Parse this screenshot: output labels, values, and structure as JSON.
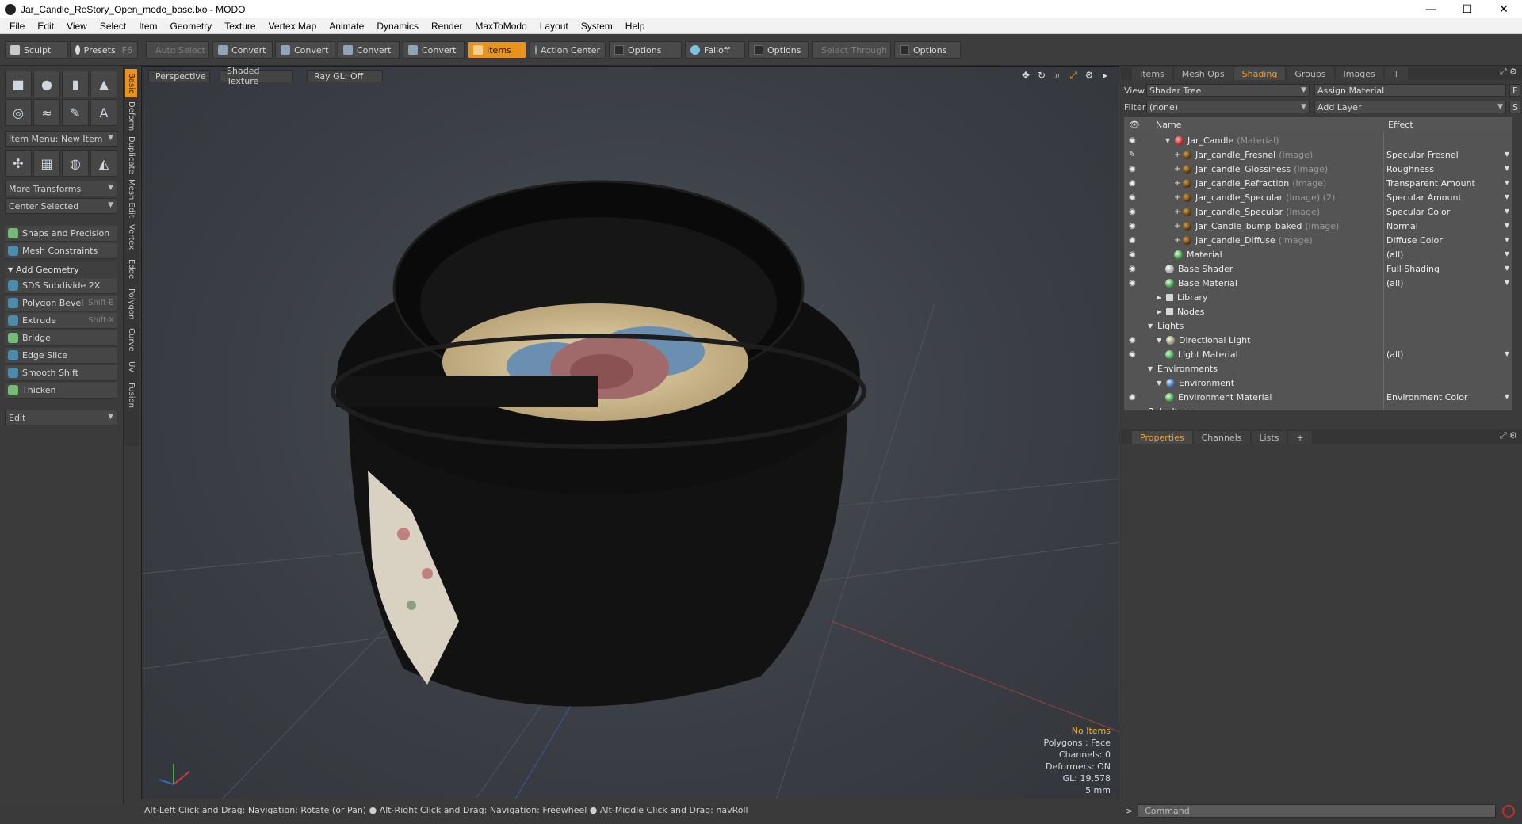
{
  "window": {
    "title": "Jar_Candle_ReStory_Open_modo_base.lxo - MODO",
    "minimize": "—",
    "maximize": "☐",
    "close": "✕"
  },
  "menu": [
    "File",
    "Edit",
    "View",
    "Select",
    "Item",
    "Geometry",
    "Texture",
    "Vertex Map",
    "Animate",
    "Dynamics",
    "Render",
    "MaxToModo",
    "Layout",
    "System",
    "Help"
  ],
  "toolbar": {
    "sculpt": "Sculpt",
    "presets": "Presets",
    "presets_hotkey": "F6",
    "auto_select": "Auto Select",
    "convert1": "Convert",
    "convert2": "Convert",
    "convert3": "Convert",
    "convert4": "Convert",
    "items": "Items",
    "action_center": "Action Center",
    "options1": "Options",
    "falloff": "Falloff",
    "options2": "Options",
    "select_through": "Select Through",
    "options3": "Options"
  },
  "left": {
    "item_menu": "Item Menu: New Item",
    "more_transforms": "More Transforms",
    "center_selected": "Center Selected",
    "snaps": "Snaps and Precision",
    "mesh_constraints": "Mesh Constraints",
    "add_geometry": "Add Geometry",
    "tools": [
      {
        "label": "SDS Subdivide 2X",
        "hotkey": ""
      },
      {
        "label": "Polygon Bevel",
        "hotkey": "Shift-B"
      },
      {
        "label": "Extrude",
        "hotkey": "Shift-X"
      },
      {
        "label": "Bridge",
        "hotkey": ""
      },
      {
        "label": "Edge Slice",
        "hotkey": ""
      },
      {
        "label": "Smooth Shift",
        "hotkey": ""
      },
      {
        "label": "Thicken",
        "hotkey": ""
      }
    ],
    "edit": "Edit"
  },
  "sidetabs": [
    "Basic",
    "Deform",
    "Duplicate",
    "Mesh Edit",
    "Vertex",
    "Edge",
    "Polygon",
    "Curve",
    "UV",
    "Fusion"
  ],
  "viewport": {
    "perspective": "Perspective",
    "shaded_texture": "Shaded Texture",
    "ray_gl": "Ray GL: Off",
    "info": {
      "no_items": "No Items",
      "polygons": "Polygons : Face",
      "channels": "Channels: 0",
      "deformers": "Deformers: ON",
      "gl": "GL: 19,578",
      "unit": "5 mm"
    }
  },
  "statusbar": "Alt-Left Click and Drag: Navigation: Rotate (or Pan) ● Alt-Right Click and Drag: Navigation: Freewheel ● Alt-Middle Click and Drag: navRoll",
  "right": {
    "tabs": [
      "Items",
      "Mesh Ops",
      "Shading",
      "Groups",
      "Images"
    ],
    "plus": "+",
    "view_label": "View",
    "view_value": "Shader Tree",
    "assign_material": "Assign Material",
    "f_btn": "F",
    "filter_label": "Filter",
    "filter_value": "(none)",
    "add_layer": "Add Layer",
    "s_btn": "S",
    "col_name": "Name",
    "col_effect": "Effect",
    "tree": [
      {
        "name": "Jar_Candle",
        "sub": "(Material)",
        "effect": "",
        "indent": 2,
        "icon": "red",
        "eye": true,
        "tri": "▼"
      },
      {
        "name": "Jar_candle_Fresnel",
        "sub": "(Image)",
        "effect": "Specular Fresnel",
        "indent": 3,
        "icon": "img",
        "eye": "brush",
        "plus": true
      },
      {
        "name": "Jar_candle_Glossiness",
        "sub": "(Image)",
        "effect": "Roughness",
        "indent": 3,
        "icon": "img",
        "eye": true,
        "plus": true
      },
      {
        "name": "Jar_candle_Refraction",
        "sub": "(Image)",
        "effect": "Transparent Amount",
        "indent": 3,
        "icon": "img",
        "eye": true,
        "plus": true
      },
      {
        "name": "Jar_candle_Specular",
        "sub": "(Image) (2)",
        "effect": "Specular Amount",
        "indent": 3,
        "icon": "img",
        "eye": true,
        "plus": true
      },
      {
        "name": "Jar_candle_Specular",
        "sub": "(Image)",
        "effect": "Specular Color",
        "indent": 3,
        "icon": "img",
        "eye": true,
        "plus": true
      },
      {
        "name": "Jar_Candle_bump_baked",
        "sub": "(Image)",
        "effect": "Normal",
        "indent": 3,
        "icon": "img",
        "eye": true,
        "plus": true
      },
      {
        "name": "Jar_candle_Diffuse",
        "sub": "(Image)",
        "effect": "Diffuse Color",
        "indent": 3,
        "icon": "img",
        "eye": true,
        "plus": true
      },
      {
        "name": "Material",
        "sub": "",
        "effect": "(all)",
        "indent": 3,
        "icon": "mat",
        "eye": true
      },
      {
        "name": "Base Shader",
        "sub": "",
        "effect": "Full Shading",
        "indent": 2,
        "icon": "shader",
        "eye": true
      },
      {
        "name": "Base Material",
        "sub": "",
        "effect": "(all)",
        "indent": 2,
        "icon": "mat",
        "eye": true
      },
      {
        "name": "Library",
        "sub": "",
        "effect": "",
        "indent": 1,
        "icon": "folder",
        "eye": false,
        "tri": "▶"
      },
      {
        "name": "Nodes",
        "sub": "",
        "effect": "",
        "indent": 1,
        "icon": "folder",
        "eye": false,
        "tri": "▶"
      },
      {
        "name": "Lights",
        "sub": "",
        "effect": "",
        "indent": 0,
        "icon": "",
        "eye": false,
        "tri": "▼"
      },
      {
        "name": "Directional Light",
        "sub": "",
        "effect": "",
        "indent": 1,
        "icon": "light",
        "eye": true,
        "tri": "▼"
      },
      {
        "name": "Light Material",
        "sub": "",
        "effect": "(all)",
        "indent": 2,
        "icon": "mat",
        "eye": true
      },
      {
        "name": "Environments",
        "sub": "",
        "effect": "",
        "indent": 0,
        "icon": "",
        "eye": false,
        "tri": "▼"
      },
      {
        "name": "Environment",
        "sub": "",
        "effect": "",
        "indent": 1,
        "icon": "env",
        "eye": false,
        "tri": "▼"
      },
      {
        "name": "Environment Material",
        "sub": "",
        "effect": "Environment Color",
        "indent": 2,
        "icon": "mat",
        "eye": true
      },
      {
        "name": "Bake Items",
        "sub": "",
        "effect": "",
        "indent": 0,
        "icon": "",
        "eye": false
      }
    ],
    "prop_tabs": [
      "Properties",
      "Channels",
      "Lists"
    ],
    "command_prompt": ">",
    "command_placeholder": "Command"
  },
  "colors": {
    "accent": "#e8931c",
    "panel": "#3b3b3b",
    "tree_bg": "#545454"
  }
}
